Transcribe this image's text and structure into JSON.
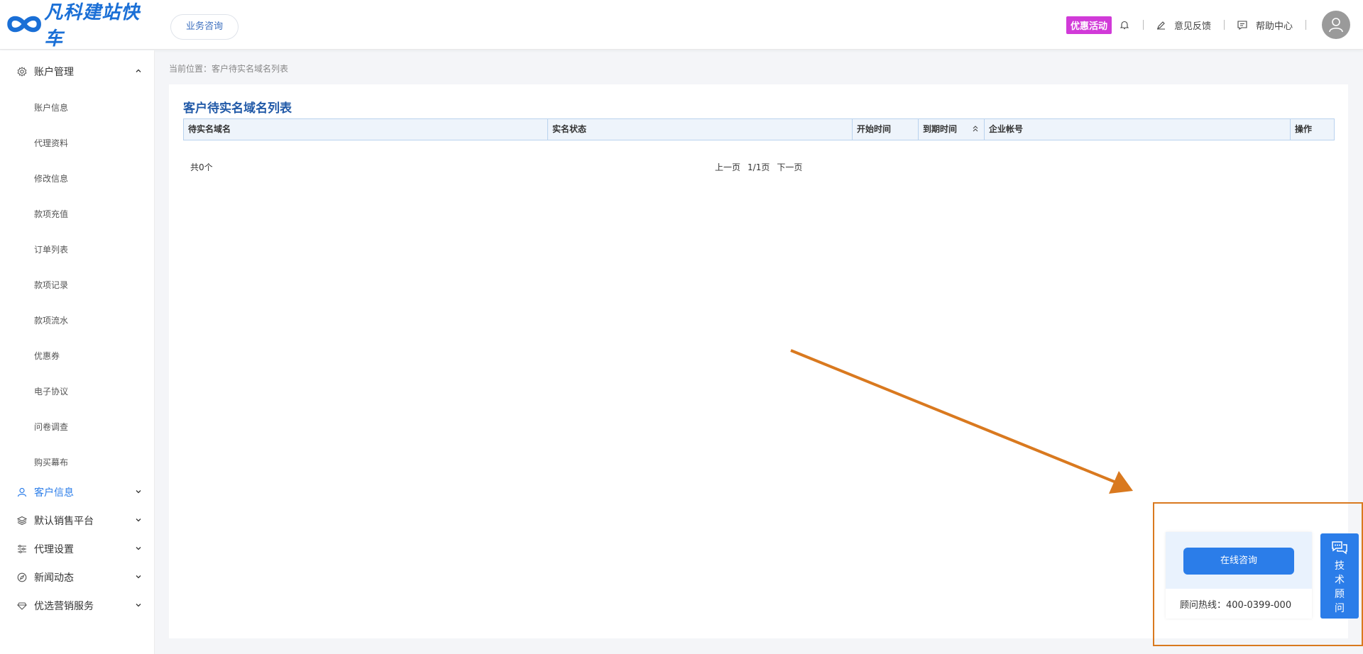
{
  "header": {
    "logo_text": "凡科建站快车",
    "consult_label": "业务咨询",
    "promo_label": "优惠活动",
    "feedback_label": "意见反馈",
    "help_label": "帮助中心"
  },
  "sidebar": {
    "account_group": "账户管理",
    "account_items": [
      "账户信息",
      "代理资料",
      "修改信息",
      "款项充值",
      "订单列表",
      "款项记录",
      "款项流水",
      "优惠券",
      "电子协议",
      "问卷调查",
      "购买幕布"
    ],
    "groups": [
      "客户信息",
      "默认销售平台",
      "代理设置",
      "新闻动态",
      "优选营销服务"
    ]
  },
  "breadcrumb": "当前位置：客户待实名域名列表",
  "main": {
    "title": "客户待实名域名列表",
    "columns": [
      "待实名域名",
      "实名状态",
      "开始时间",
      "到期时间",
      "企业帐号",
      "操作"
    ],
    "total": "共0个",
    "pager": {
      "prev": "上一页",
      "page": "1/1页",
      "next": "下一页"
    }
  },
  "widget": {
    "online_label": "在线咨询",
    "hotline": "顾问热线：400-0399-000",
    "tech_chars": [
      "技",
      "术",
      "顾",
      "问"
    ]
  },
  "colors": {
    "accent": "#2b7de9",
    "title_blue": "#225aa8",
    "promo": "#d13ad8",
    "annotation": "#d9791f"
  }
}
